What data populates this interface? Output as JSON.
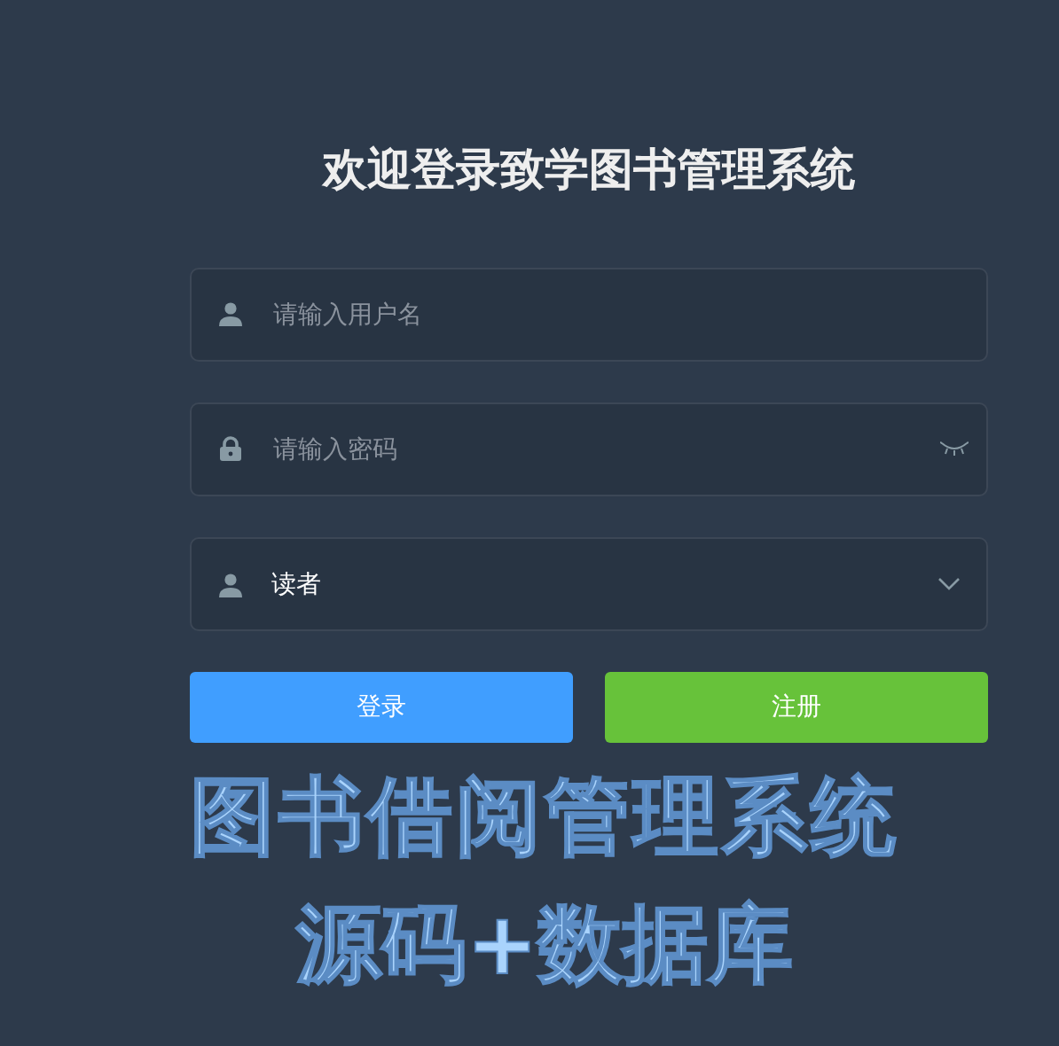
{
  "title": "欢迎登录致学图书管理系统",
  "fields": [
    {
      "kind": "text",
      "placeholder": "请输入用户名"
    },
    {
      "kind": "password",
      "placeholder": "请输入密码"
    },
    {
      "kind": "select",
      "value": "读者"
    }
  ],
  "buttons": [
    {
      "kind": "primary",
      "label": "登录"
    },
    {
      "kind": "success",
      "label": "注册"
    }
  ],
  "caption": [
    "图书借阅管理系统",
    "源码+数据库"
  ]
}
